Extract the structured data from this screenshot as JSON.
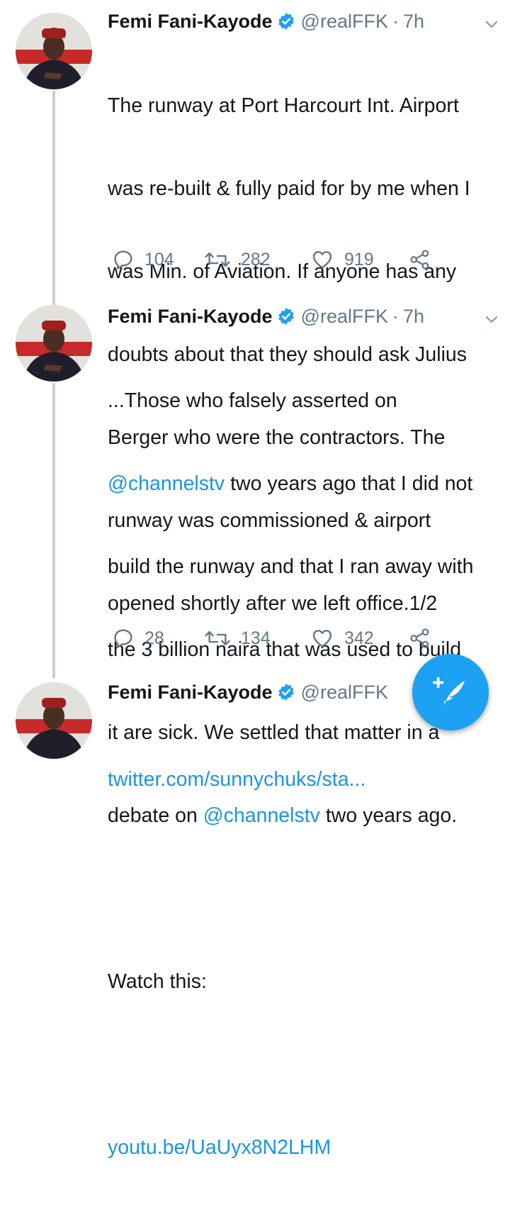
{
  "tweets": [
    {
      "name": "Femi Fani-Kayode",
      "handle": "@realFFK",
      "sep": "·",
      "time": "7h",
      "lines": [
        "The runway at Port Harcourt Int. Airport",
        "was re-built & fully paid for by me when I",
        "was Min. of Aviation. If anyone has any",
        "doubts about that they should ask Julius",
        "Berger who were the contractors. The",
        "runway was commissioned & airport",
        "opened shortly after we left office.1/2"
      ],
      "replies": "104",
      "retweets": "282",
      "likes": "919"
    },
    {
      "name": "Femi Fani-Kayode",
      "handle": "@realFFK",
      "sep": "·",
      "time": "7h",
      "line1": "...Those who falsely asserted on",
      "mention1": "@channelstv",
      "line2_rest": " two years ago that I did not",
      "line3": "build the runway and that I ran away with",
      "line4": "the 3 billion naira that was used to build",
      "line5": "it are sick. We settled that matter in a",
      "line6_pre": "debate on ",
      "mention2": "@channelstv",
      "line6_rest": " two years ago.",
      "watch": "Watch this:",
      "url": "youtu.be/UaUyx8N2LHM",
      "replies": "28",
      "retweets": "134",
      "likes": "342"
    },
    {
      "name": "Femi Fani-Kayode",
      "handle": "@realFFK",
      "link": "twitter.com/sunnychuks/sta..."
    }
  ],
  "colors": {
    "accent": "#1da1f2",
    "link": "#1b95e0",
    "muted": "#657786",
    "thread": "#c7d0d7"
  },
  "icons": [
    "verified-badge-icon",
    "chevron-down-icon",
    "reply-icon",
    "retweet-icon",
    "like-icon",
    "share-icon",
    "compose-tweet-icon"
  ]
}
